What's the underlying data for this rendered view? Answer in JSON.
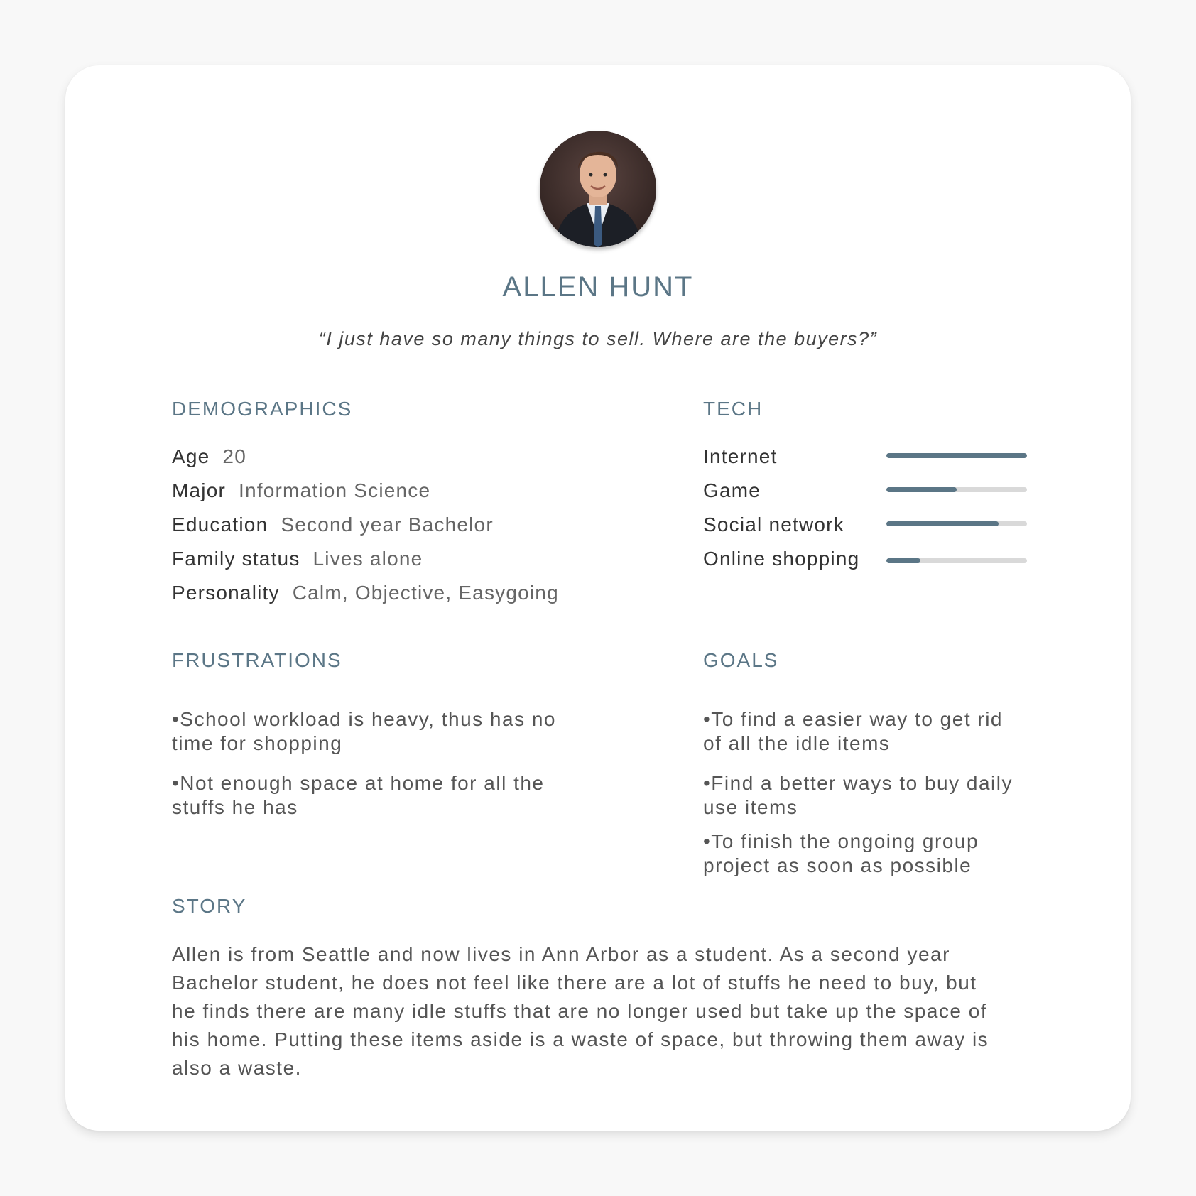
{
  "persona": {
    "name": "ALLEN HUNT",
    "quote": "“I just have so many things to sell. Where are the buyers?”",
    "avatar_icon": "person-portrait-icon"
  },
  "demographics": {
    "title": "DEMOGRAPHICS",
    "rows": [
      {
        "label": "Age",
        "value": "20"
      },
      {
        "label": "Major",
        "value": "Information Science"
      },
      {
        "label": "Education",
        "value": "Second year Bachelor"
      },
      {
        "label": "Family status",
        "value": "Lives alone"
      },
      {
        "label": "Personality",
        "value": "Calm, Objective, Easygoing"
      }
    ]
  },
  "tech": {
    "title": "TECH",
    "items": [
      {
        "label": "Internet",
        "level": 1.0
      },
      {
        "label": "Game",
        "level": 0.5
      },
      {
        "label": "Social network",
        "level": 0.8
      },
      {
        "label": "Online shopping",
        "level": 0.24
      }
    ]
  },
  "frustrations": {
    "title": "FRUSTRATIONS",
    "items": [
      {
        "line1": "•School workload is heavy, thus has no",
        "line2": "time for shopping"
      },
      {
        "line1": "•Not enough space at home for all the",
        "line2": "stuffs he has"
      }
    ]
  },
  "goals": {
    "title": "GOALS",
    "items": [
      {
        "line1": "•To find a easier way to get rid",
        "line2": "of all the idle items"
      },
      {
        "line1": "•Find a better ways to buy daily",
        "line2": "use items"
      },
      {
        "line1": "•To finish the ongoing group",
        "line2": "project as soon as possible"
      }
    ]
  },
  "story": {
    "title": "STORY",
    "lines": [
      "Allen is from Seattle and now lives in Ann Arbor as a student. As a second year",
      "Bachelor student, he does not feel like there are a lot of stuffs he need to buy, but",
      "he finds there are many idle stuffs that are no longer used but take up the space of",
      "his home. Putting these items aside is a waste of space, but throwing them away is",
      "also a waste."
    ]
  },
  "colors": {
    "accent": "#5b7686",
    "track": "#d9d9d9",
    "background": "#f8f8f8",
    "card": "#ffffff"
  }
}
